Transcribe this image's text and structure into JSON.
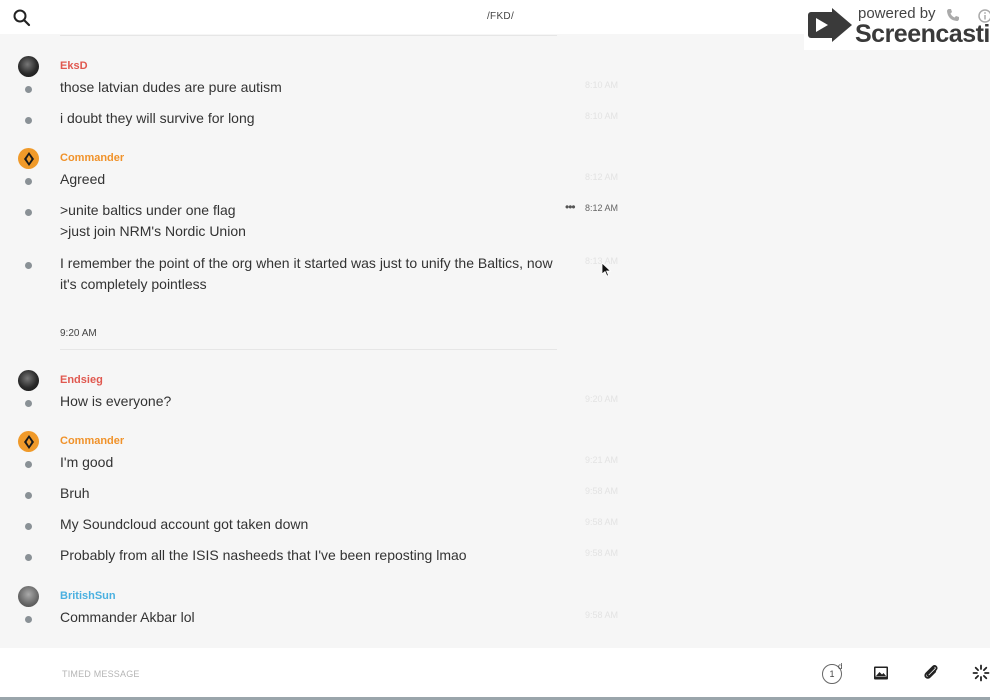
{
  "header": {
    "channel_title": "/FKD/",
    "search_icon": "search-icon"
  },
  "watermark": {
    "line1": "powered by",
    "line2": "Screencastify"
  },
  "messages": [
    {
      "author": "EksD",
      "author_color": "#e0584f",
      "avatar": "dark",
      "lines": [
        {
          "text": "those latvian dudes are pure autism",
          "time": "8:10 AM"
        },
        {
          "text": "i doubt they will survive for long",
          "time": "8:10 AM"
        }
      ]
    },
    {
      "author": "Commander",
      "author_color": "#f0922a",
      "avatar": "commander",
      "lines": [
        {
          "text": "Agreed",
          "time": "8:12 AM"
        },
        {
          "text": ">unite baltics under one flag\n>just join NRM's Nordic Union",
          "time": "8:12 AM"
        },
        {
          "text": "I remember the point of the org when it started was just to unify the Baltics, now it's completely pointless",
          "time": "8:13 AM"
        }
      ]
    },
    {
      "separator": "9:20 AM"
    },
    {
      "author": "Endsieg",
      "author_color": "#e0584f",
      "avatar": "dark",
      "lines": [
        {
          "text": "How is everyone?",
          "time": "9:20 AM"
        }
      ]
    },
    {
      "author": "Commander",
      "author_color": "#f0922a",
      "avatar": "commander",
      "lines": [
        {
          "text": "I'm good",
          "time": "9:21 AM"
        },
        {
          "text": "Bruh",
          "time": "9:58 AM"
        },
        {
          "text": "My Soundcloud account got taken down",
          "time": "9:58 AM"
        },
        {
          "text": "Probably from all the ISIS nasheeds that I've been reposting lmao",
          "time": "9:58 AM"
        }
      ]
    },
    {
      "author": "BritishSun",
      "author_color": "#4ab0e0",
      "avatar": "grey",
      "lines": [
        {
          "text": "Commander Akbar lol",
          "time": "9:58 AM"
        }
      ]
    }
  ],
  "composer": {
    "placeholder": "TIMED MESSAGE",
    "timer_value": "1",
    "timer_unit": "d"
  }
}
